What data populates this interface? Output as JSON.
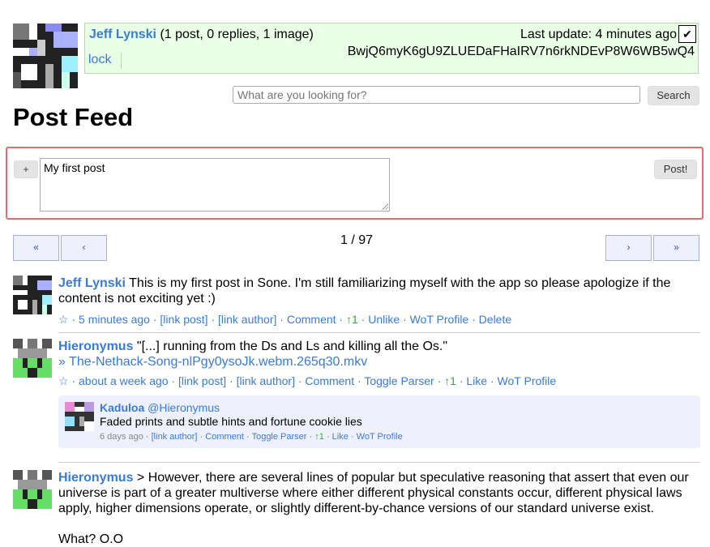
{
  "header": {
    "user_name": "Jeff Lynski",
    "stats": "(1 post, 0 replies, 1 image)",
    "last_update": "Last update: 4 minutes ago",
    "check": "✔",
    "lock": "lock",
    "key": "BwjQ6myK6gU9ZLUEDaFHaIRV7n6rkNDEvP8W6WB5wQ4"
  },
  "search": {
    "placeholder": "What are you looking for?",
    "button": "Search"
  },
  "page_title": "Post Feed",
  "composer": {
    "plus": "+",
    "text": "My first post",
    "post_button": "Post!"
  },
  "pagination": {
    "first": "«",
    "prev": "‹",
    "info": "1 / 97",
    "next": "›",
    "last": "»"
  },
  "posts": [
    {
      "author": "Jeff Lynski",
      "text": " This is my first post in Sone. I'm still familiarizing myself with the app so please apologize if the content is not exciting yet :)",
      "meta": {
        "star": "☆",
        "time": "5 minutes ago",
        "link_post": "[link post]",
        "link_author": "[link author]",
        "comment": "Comment",
        "likes": "↑1",
        "like_action": "Unlike",
        "wot": "WoT Profile",
        "delete": "Delete"
      }
    },
    {
      "author": "Hieronymus",
      "text": " \"[...] running from the Ds and Ls and killing all the Os.\"",
      "attachment": "» The-Nethack-Song-nlPgy0ysoJk.webm.265q30.mkv",
      "meta": {
        "star": "☆",
        "time": "about a week ago",
        "link_post": "[link post]",
        "link_author": "[link author]",
        "comment": "Comment",
        "toggle": "Toggle Parser",
        "likes": "↑1",
        "like_action": "Like",
        "wot": "WoT Profile"
      },
      "reply": {
        "author": "Kaduloa",
        "mention": "@Hieronymus",
        "text": "Faded prints and subtle hints and fortune cookie lies",
        "time": "6 days ago",
        "link_author": "[link author]",
        "comment": "Comment",
        "toggle": "Toggle Parser",
        "likes": "↑1",
        "like_action": "Like",
        "wot": "WoT Profile"
      }
    },
    {
      "author": "Hieronymus",
      "text": " > However, there are several lines of popular but speculative reasoning that assert that even our universe is part of a greater multiverse where either different physical constants occur, different physical laws apply, higher dimensions operate, or slightly different-by-chance versions of our standard universe exist.",
      "text2": "What? O.O"
    }
  ]
}
